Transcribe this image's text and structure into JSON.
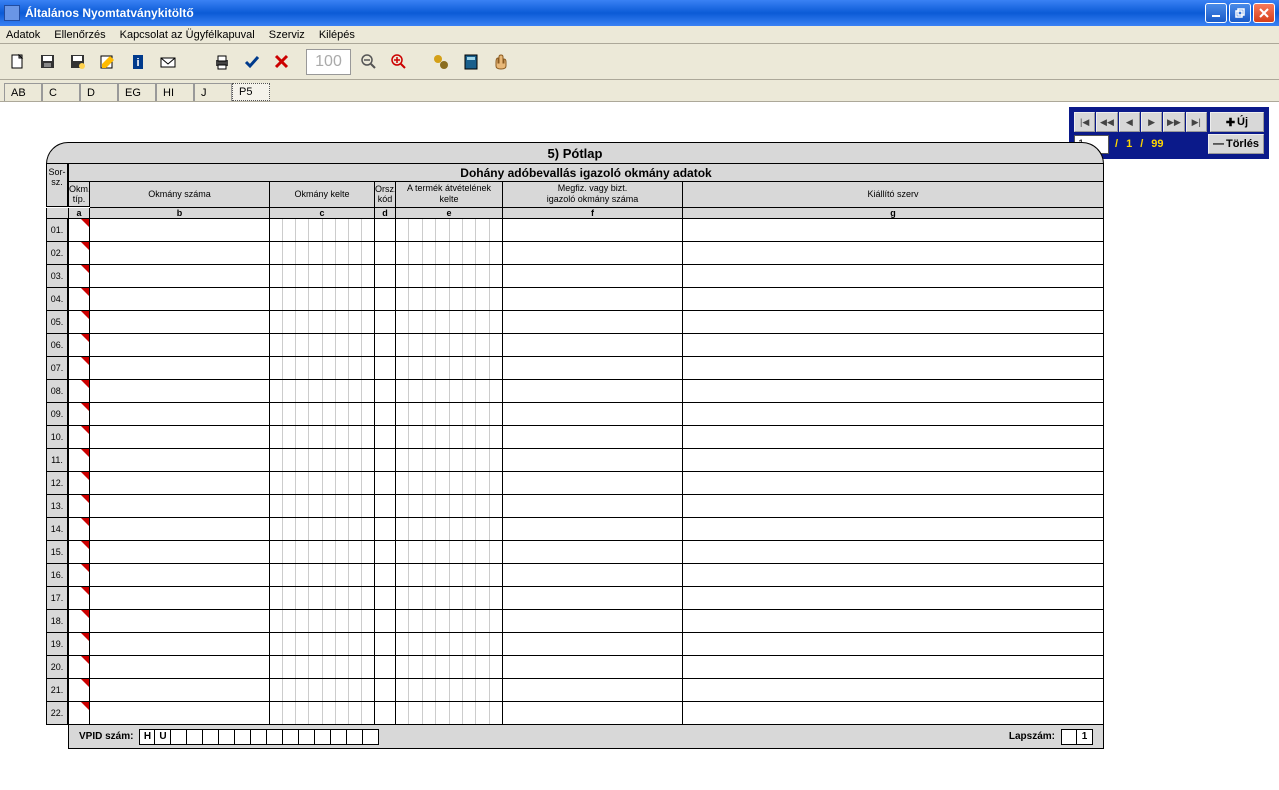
{
  "window": {
    "title": "Általános Nyomtatványkitöltő"
  },
  "menu": {
    "items": [
      "Adatok",
      "Ellenőrzés",
      "Kapcsolat az Ügyfélkapuval",
      "Szerviz",
      "Kilépés"
    ]
  },
  "toolbar": {
    "zoom": "100"
  },
  "tabs": {
    "items": [
      "AB",
      "C",
      "D",
      "EG",
      "HI",
      "J",
      "P5"
    ],
    "active": "P5"
  },
  "navigator": {
    "new_label": "Új",
    "delete_label": "Törlés",
    "current": "1",
    "page": "1",
    "total": "99",
    "sep": "/"
  },
  "form": {
    "title": "5) Pótlap",
    "subtitle": "Dohány adóbevallás igazoló okmány adatok",
    "headers": {
      "sorsz": "Sor-\nsz.",
      "col_a": "Okm. típ.",
      "col_b": "Okmány száma",
      "col_c": "Okmány kelte",
      "col_d": "Orsz. kód",
      "col_e": "A termék átvételének kelte",
      "col_f": "Megfiz. vagy bizt. igazoló okmány száma",
      "col_g": "Kiállító szerv"
    },
    "labels": {
      "a": "a",
      "b": "b",
      "c": "c",
      "d": "d",
      "e": "e",
      "f": "f",
      "g": "g"
    },
    "rows": [
      "01.",
      "02.",
      "03.",
      "04.",
      "05.",
      "06.",
      "07.",
      "08.",
      "09.",
      "10.",
      "11.",
      "12.",
      "13.",
      "14.",
      "15.",
      "16.",
      "17.",
      "18.",
      "19.",
      "20.",
      "21.",
      "22."
    ],
    "footer": {
      "vpid_label": "VPID szám:",
      "vpid_h": "H",
      "vpid_u": "U",
      "lapszam_label": "Lapszám:",
      "lapszam_value": "1"
    }
  }
}
